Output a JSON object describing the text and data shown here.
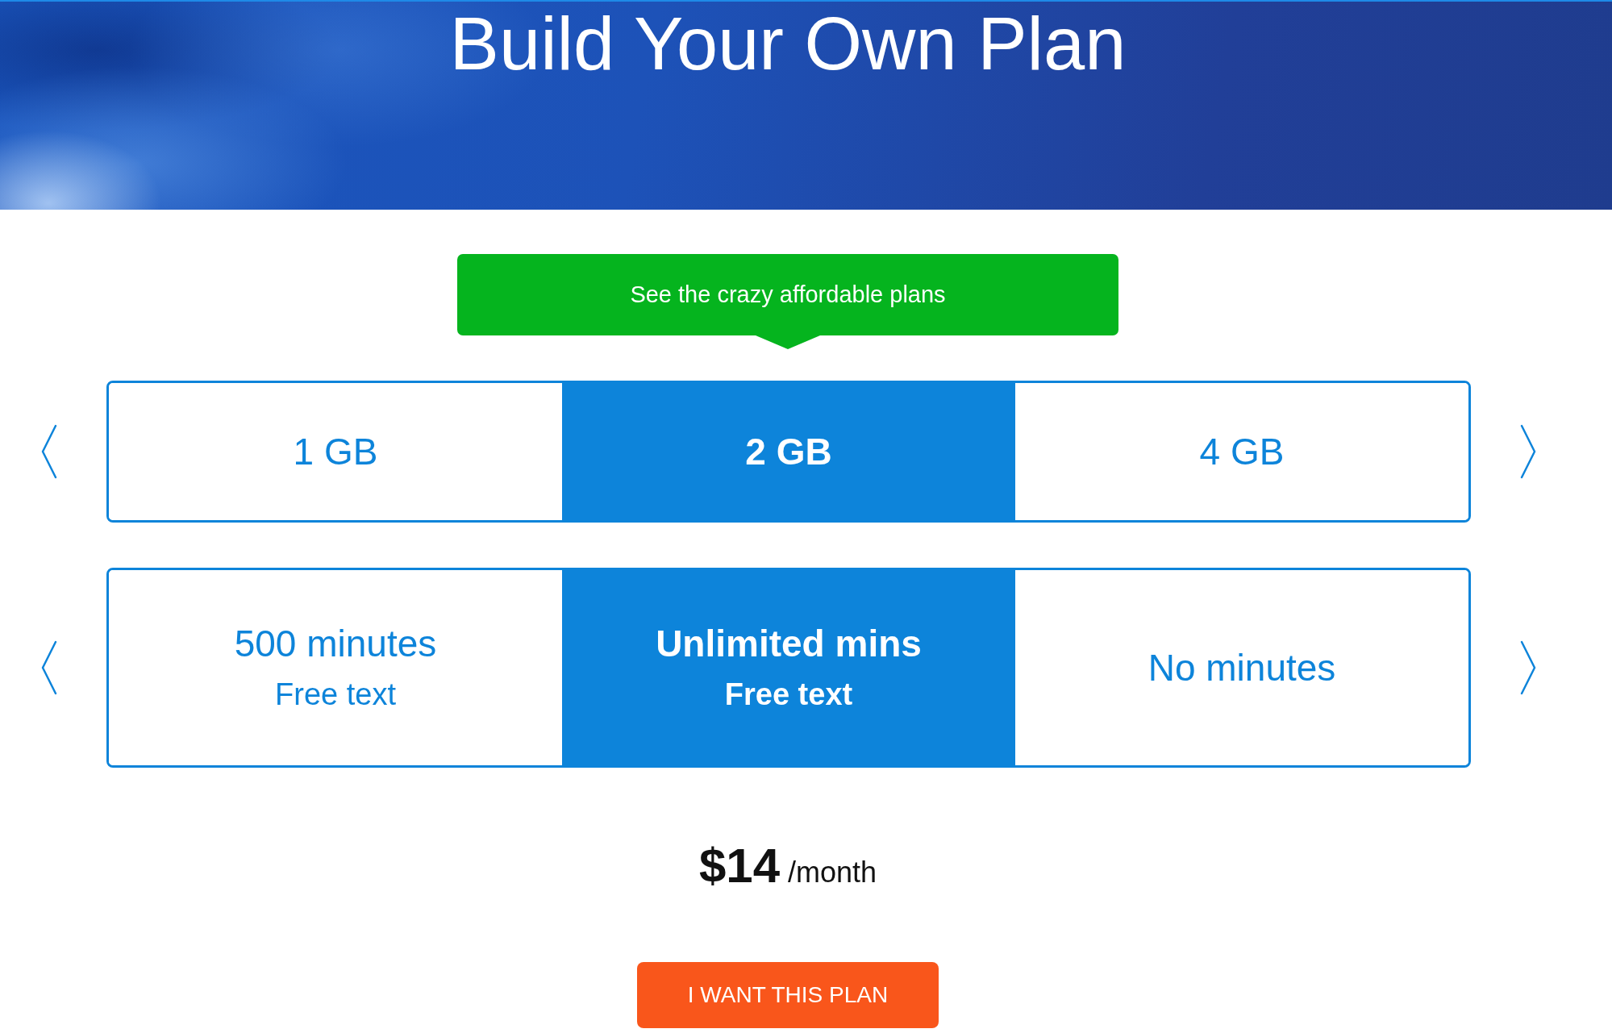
{
  "header": {
    "title": "Build Your Own Plan"
  },
  "callout": {
    "label": "See the crazy affordable plans"
  },
  "data_options": [
    {
      "label": "1 GB",
      "selected": false
    },
    {
      "label": "2 GB",
      "selected": true
    },
    {
      "label": "4 GB",
      "selected": false
    }
  ],
  "minute_options": [
    {
      "minutes": "500 minutes",
      "texts": "Free text",
      "selected": false
    },
    {
      "minutes": "Unlimited mins",
      "texts": "Free text",
      "selected": true
    },
    {
      "minutes": "No minutes",
      "selected": false
    }
  ],
  "price": {
    "amount": "$14",
    "period": "/month"
  },
  "cta_button": {
    "label": "I WANT THIS PLAN"
  }
}
